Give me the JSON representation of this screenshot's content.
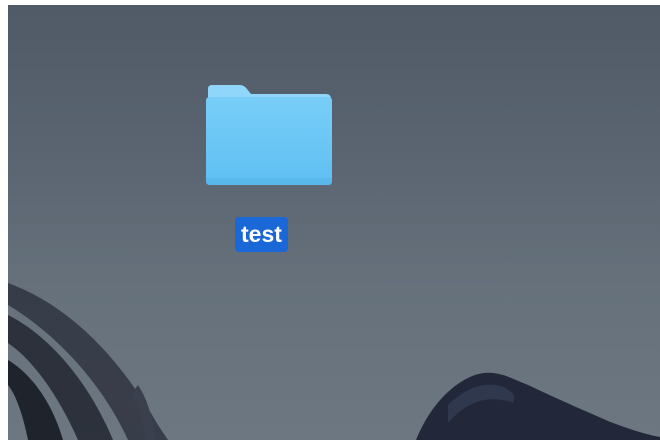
{
  "desktop": {
    "items": [
      {
        "name": "test",
        "icon": "folder-icon",
        "selected": true
      }
    ]
  },
  "colors": {
    "wallpaper_top": "#4f5a66",
    "wallpaper_bottom": "#6d7781",
    "folder_body": "#6ec9f7",
    "folder_tab": "#8fd6fa",
    "selection_label": "#1a67d8"
  }
}
